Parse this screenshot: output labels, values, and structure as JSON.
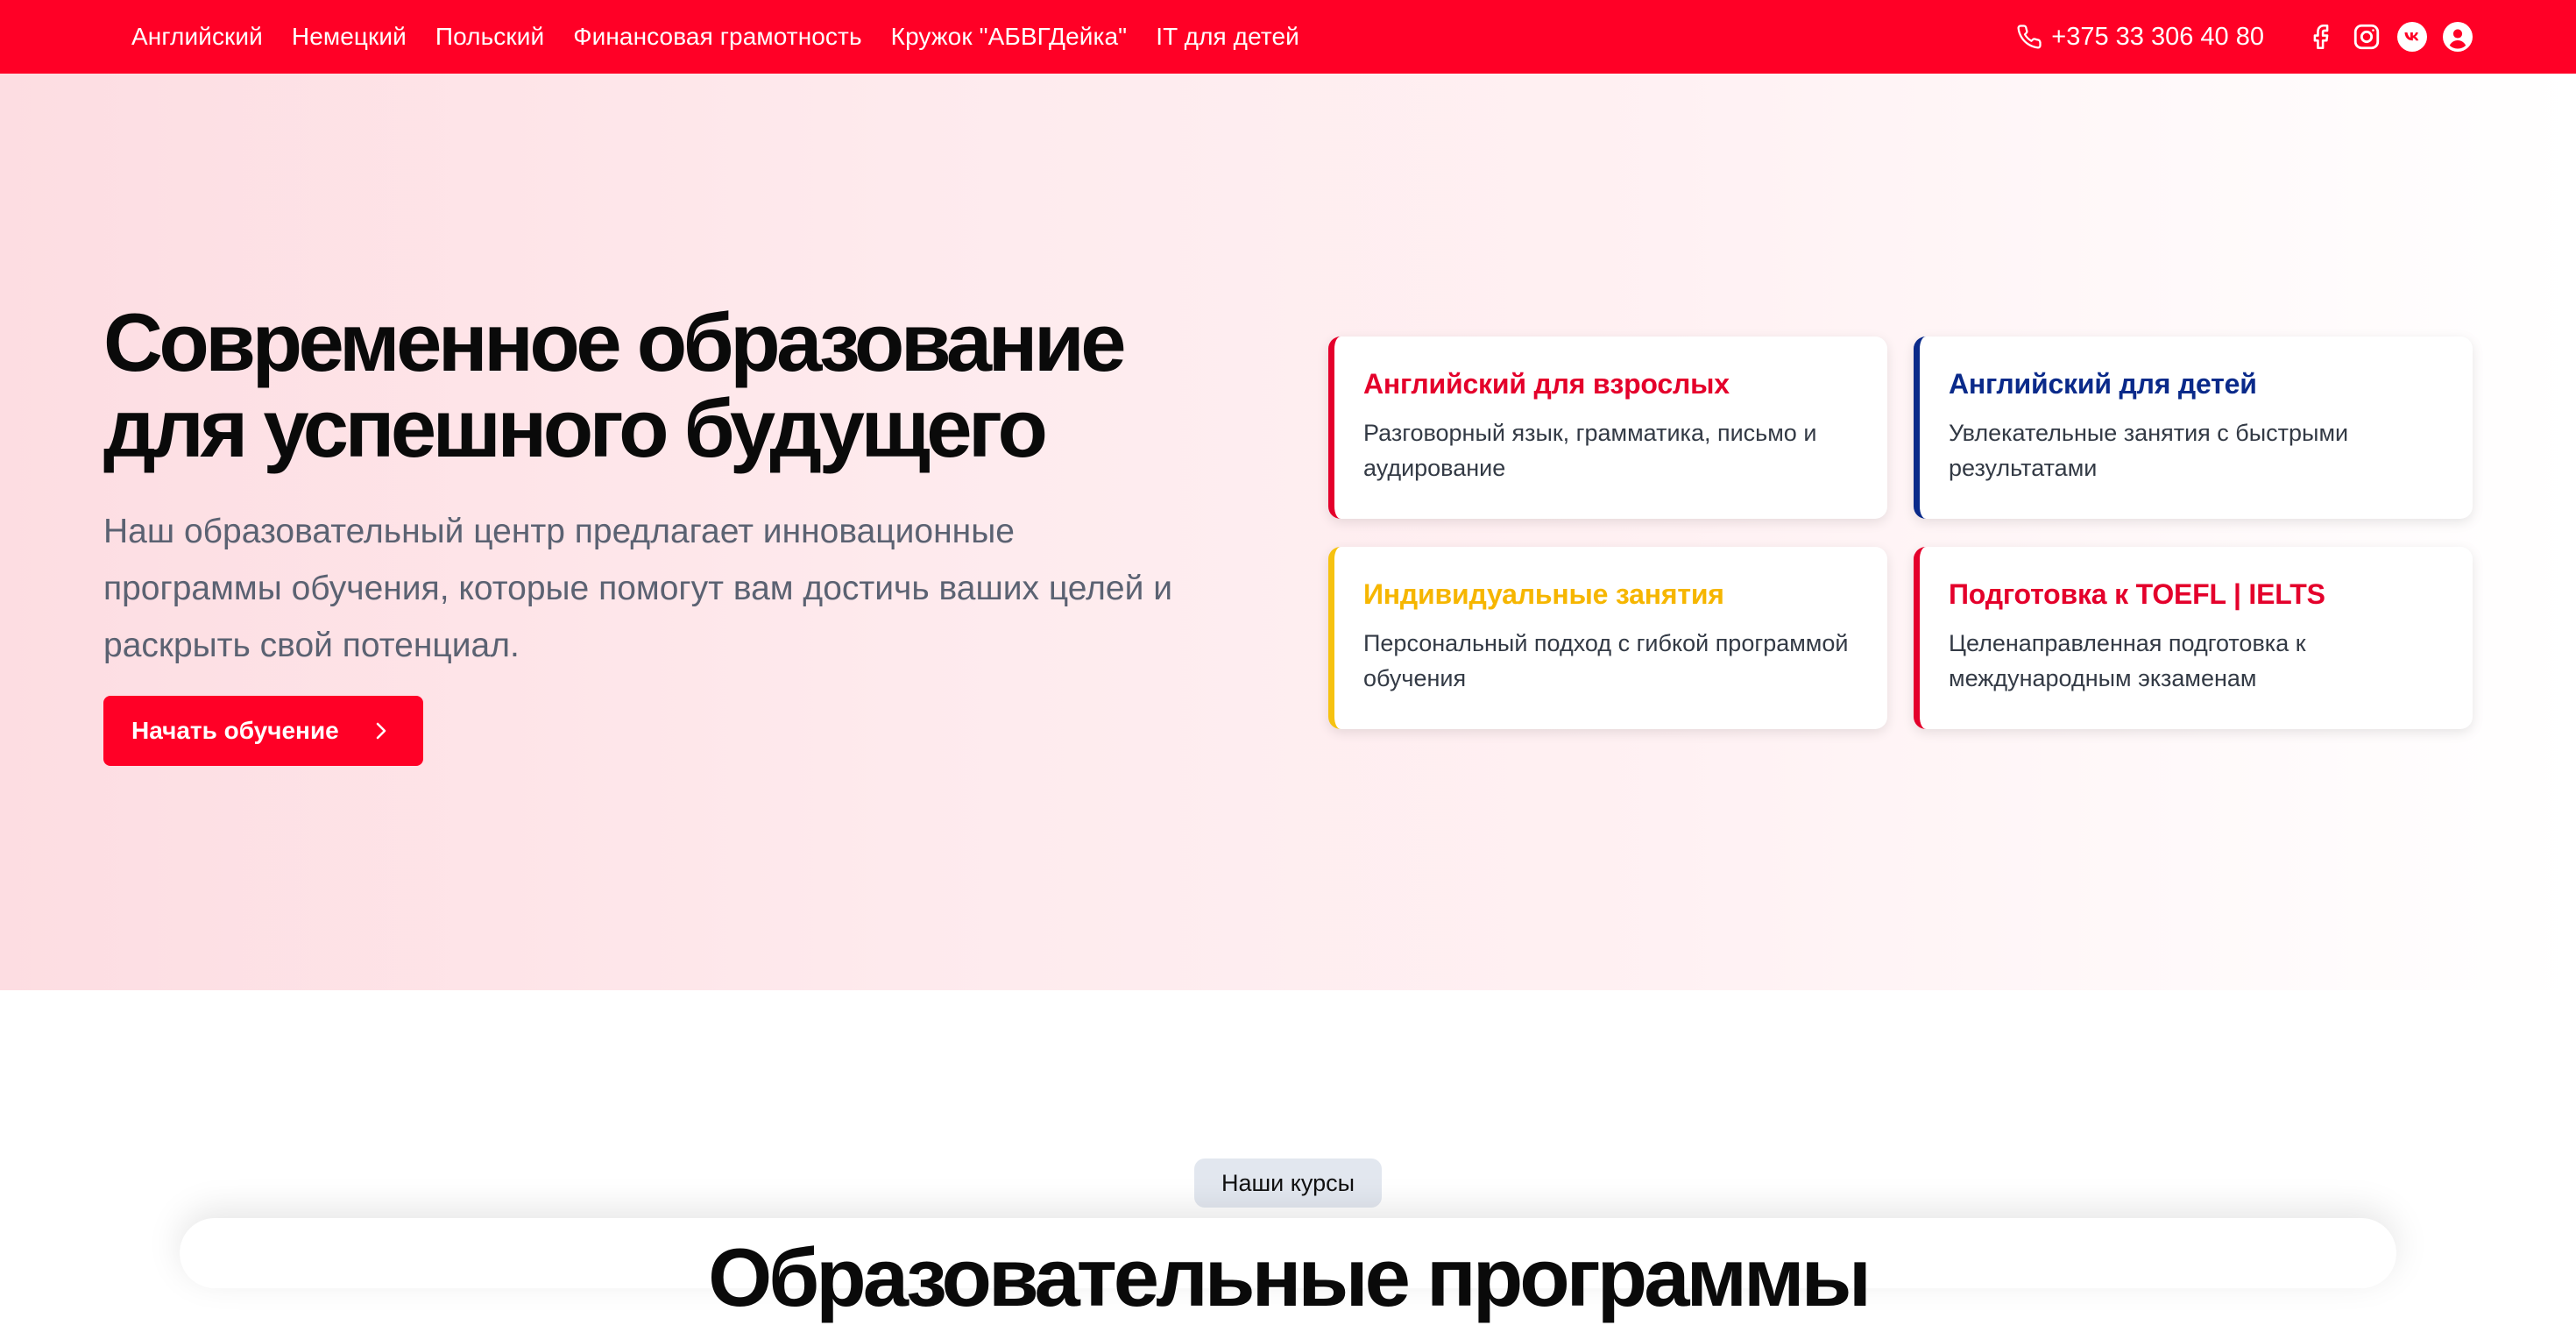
{
  "nav": {
    "links": [
      "Английский",
      "Немецкий",
      "Польский",
      "Финансовая грамотность",
      "Кружок \"АБВГДейка\"",
      "IT для детей"
    ],
    "phone": "+375 33 306 40 80",
    "social_icons": [
      "facebook-icon",
      "instagram-icon",
      "vk-icon",
      "user-account-icon"
    ]
  },
  "hero": {
    "title": "Современное образование для успешного будущего",
    "text": "Наш образовательный центр предлагает инновационные программы обучения, которые помогут вам достичь ваших целей и раскрыть свой потенциал.",
    "cta_label": "Начать обучение"
  },
  "cards": [
    {
      "title": "Английский для взрослых",
      "desc": "Разговорный язык, грамматика, письмо и аудирование",
      "accent": "#e4002b"
    },
    {
      "title": "Английский для детей",
      "desc": "Увлекательные занятия с быстрыми результатами",
      "accent": "#0a2a8a"
    },
    {
      "title": "Индивидуальные занятия",
      "desc": "Персональный подход с гибкой программой обучения",
      "accent": "#f6c210"
    },
    {
      "title": "Подготовка к TOEFL | IELTS",
      "desc": "Целенаправленная подготовка к международным экзаменам",
      "accent": "#e4002b"
    }
  ],
  "courses": {
    "badge": "Наши курсы",
    "title": "Образовательные программы"
  },
  "colors": {
    "brand_red": "#ff0026",
    "navy": "#0a2a8a",
    "yellow": "#f6c210",
    "badge_bg": "#e2e7ef"
  }
}
